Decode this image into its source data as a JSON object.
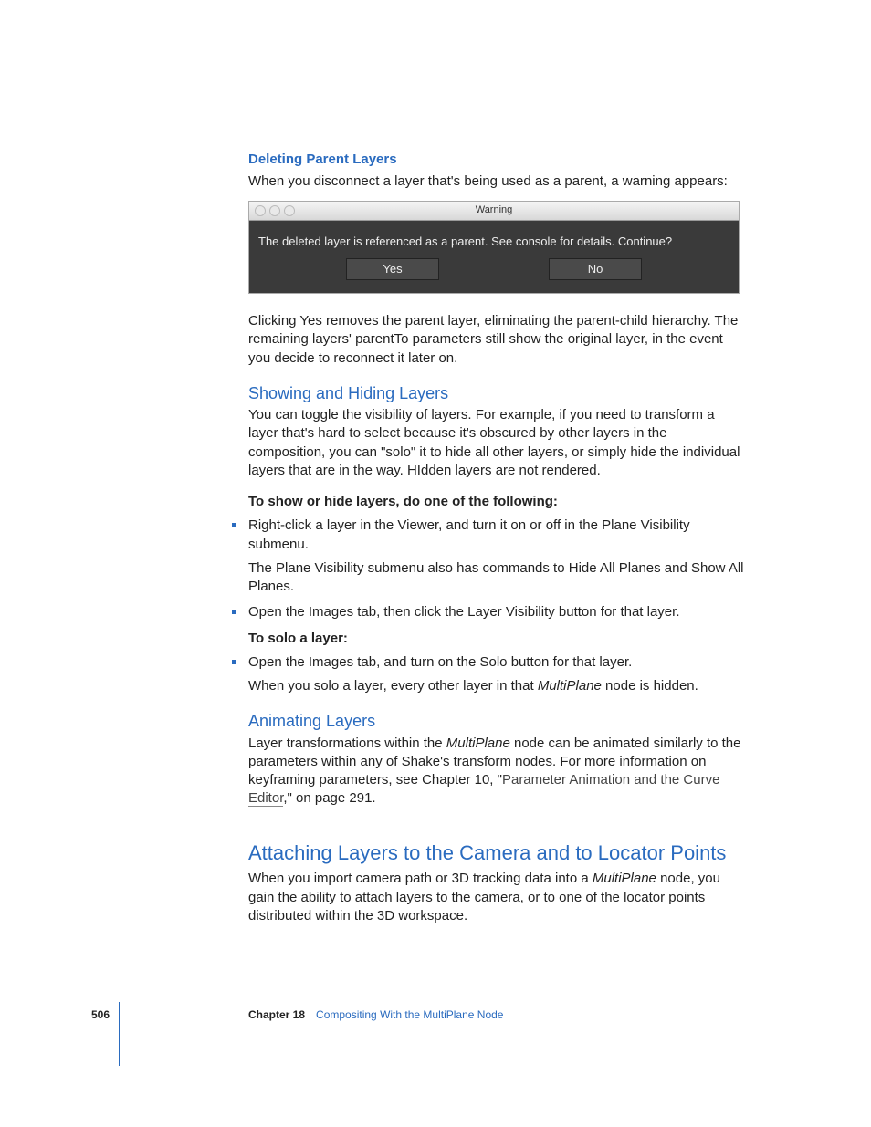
{
  "sections": {
    "deleting": {
      "heading": "Deleting Parent Layers",
      "intro": "When you disconnect a layer that's being used as a parent, a warning appears:",
      "after": "Clicking Yes removes the parent layer, eliminating the parent-child hierarchy. The remaining layers' parentTo parameters still show the original layer, in the event you decide to reconnect it later on."
    },
    "dialog": {
      "title": "Warning",
      "message": "The deleted layer is referenced as a parent.  See console for details.  Continue?",
      "yes": "Yes",
      "no": "No"
    },
    "showing": {
      "heading": "Showing and Hiding Layers",
      "para": "You can toggle the visibility of layers. For example, if you need to transform a layer that's hard to select because it's obscured by other layers in the composition, you can \"solo\" it to hide all other layers, or simply hide the individual layers that are in the way. HIdden layers are not rendered.",
      "task1_lead": "To show or hide layers, do one of the following:",
      "task1_b1": "Right-click a layer in the Viewer, and turn it on or off in the Plane Visibility submenu.",
      "task1_b1_sub": "The Plane Visibility submenu also has commands to Hide All Planes and Show All Planes.",
      "task1_b2": "Open the Images tab, then click the Layer Visibility button for that layer.",
      "task2_lead": "To solo a layer:",
      "task2_b1": "Open the Images tab, and turn on the Solo button for that layer.",
      "task2_b1_sub_a": "When you solo a layer, every other layer in that ",
      "task2_b1_sub_i": "MultiPlane",
      "task2_b1_sub_b": " node is hidden."
    },
    "animating": {
      "heading": "Animating Layers",
      "para_a": "Layer transformations within the ",
      "para_i": "MultiPlane",
      "para_b": " node can be animated similarly to the parameters within any of Shake's transform nodes. For more information on keyframing parameters, see Chapter 10, \"",
      "link": "Parameter Animation and the Curve Editor",
      "para_c": ",\" on page 291."
    },
    "attaching": {
      "heading": "Attaching Layers to the Camera and to Locator Points",
      "para_a": "When you import camera path or 3D tracking data into a ",
      "para_i": "MultiPlane",
      "para_b": " node, you gain the ability to attach layers to the camera, or to one of the locator points distributed within the 3D workspace."
    }
  },
  "footer": {
    "page": "506",
    "chapter_label": "Chapter 18",
    "chapter_title": "Compositing With the MultiPlane Node"
  }
}
